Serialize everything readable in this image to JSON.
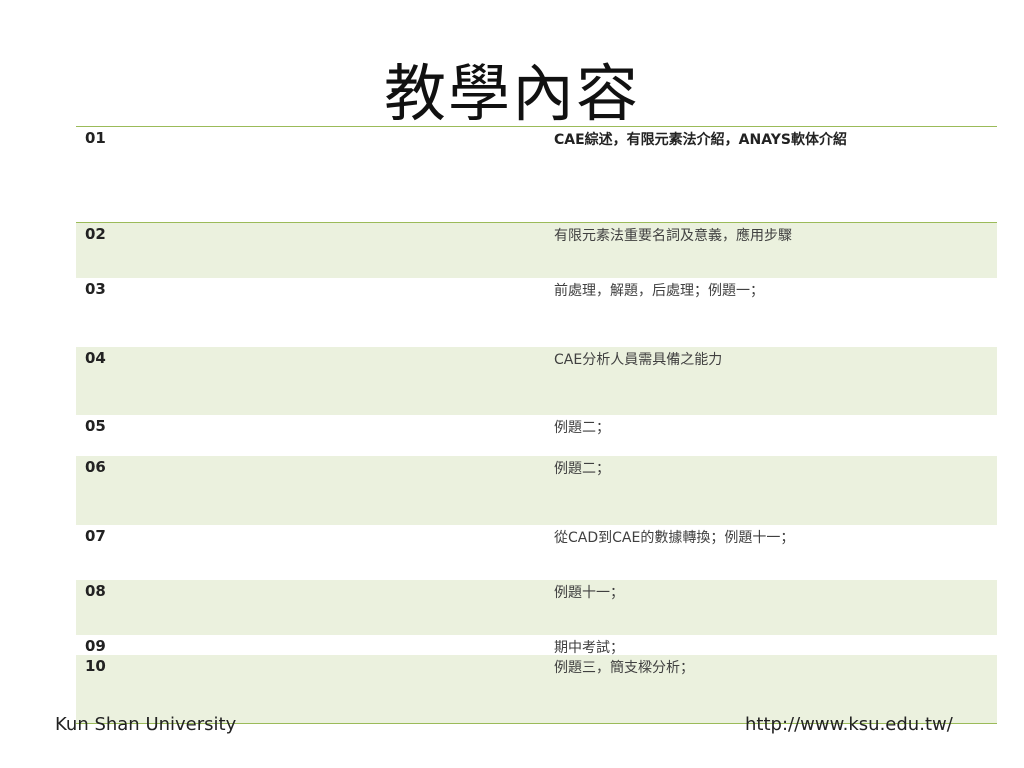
{
  "title": "教學內容",
  "rows": [
    {
      "num": "01",
      "content": "CAE綜述，有限元素法介紹，ANAYS軟体介紹"
    },
    {
      "num": "02",
      "content": "有限元素法重要名詞及意義，應用步驟"
    },
    {
      "num": "03",
      "content": "前處理，解題，后處理；例題一；"
    },
    {
      "num": "04",
      "content": "CAE分析人員需具備之能力"
    },
    {
      "num": "05",
      "content": "例題二；"
    },
    {
      "num": "06",
      "content": "例題二；"
    },
    {
      "num": "07",
      "content": "從CAD到CAE的數據轉換；例題十一；"
    },
    {
      "num": "08",
      "content": "例題十一；"
    },
    {
      "num": "09",
      "content": "期中考試；"
    },
    {
      "num": "10",
      "content": "例題三，簡支樑分析；"
    }
  ],
  "footer": {
    "left": "Kun Shan University",
    "right": "http://www.ksu.edu.tw/"
  },
  "colors": {
    "accent_line": "#9bbb59",
    "row_shade": "#ebf1de"
  }
}
